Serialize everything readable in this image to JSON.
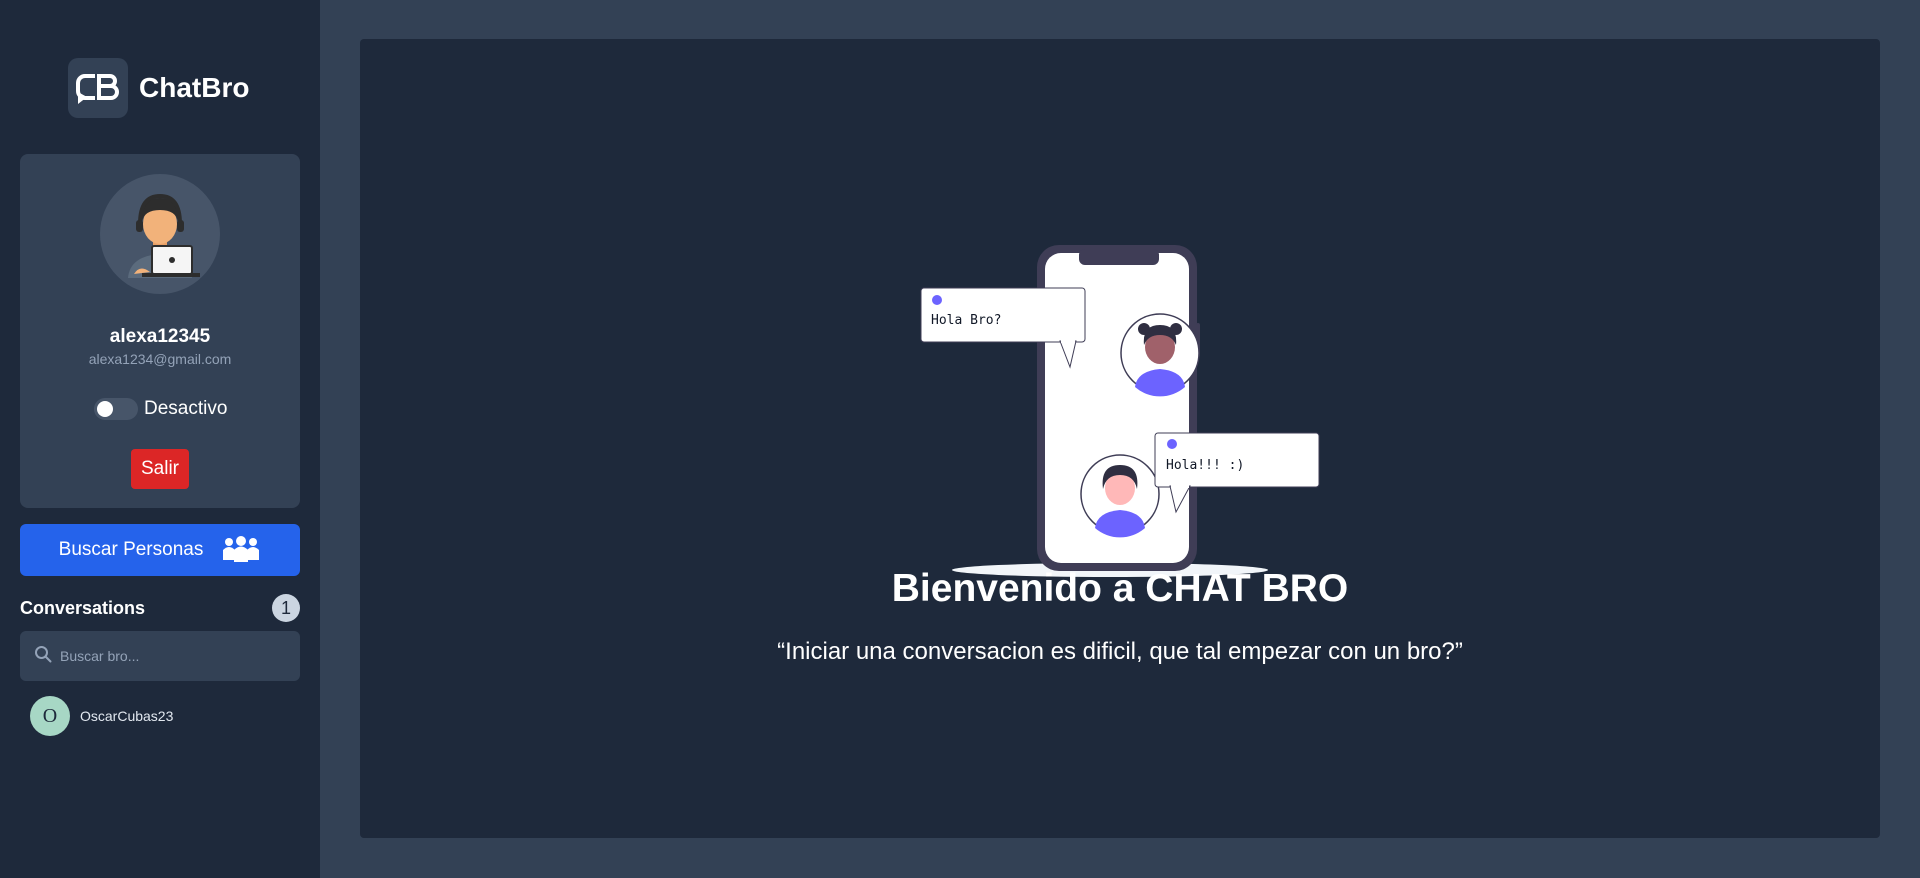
{
  "brand": {
    "logo_text": "CB",
    "name": "ChatBro"
  },
  "profile": {
    "username": "alexa12345",
    "email": "alexa1234@gmail.com",
    "status_label": "Desactivo",
    "logout_label": "Salir"
  },
  "actions": {
    "search_people_label": "Buscar Personas"
  },
  "conversations": {
    "title": "Conversations",
    "count": "1",
    "search_placeholder": "Buscar bro...",
    "items": [
      {
        "initial": "O",
        "name": "OscarCubas23",
        "avatar_color": "#a7d7c5"
      }
    ]
  },
  "welcome": {
    "bubble_1": "Hola Bro?",
    "bubble_2": "Hola!!! :)",
    "title": "Bienvenido a CHAT BRO",
    "quote": "“Iniciar una conversacion es dificil, que tal empezar con un bro?”"
  },
  "icons": {
    "logo": "chatbro-logo-icon",
    "avatar": "user-laptop-avatar-icon",
    "people": "people-group-icon",
    "search": "search-icon"
  },
  "colors": {
    "sidebar_bg": "#1e293b",
    "page_bg": "#334155",
    "primary_button": "#2563eb",
    "logout_button": "#dc2626",
    "accent_purple": "#6c63ff"
  }
}
